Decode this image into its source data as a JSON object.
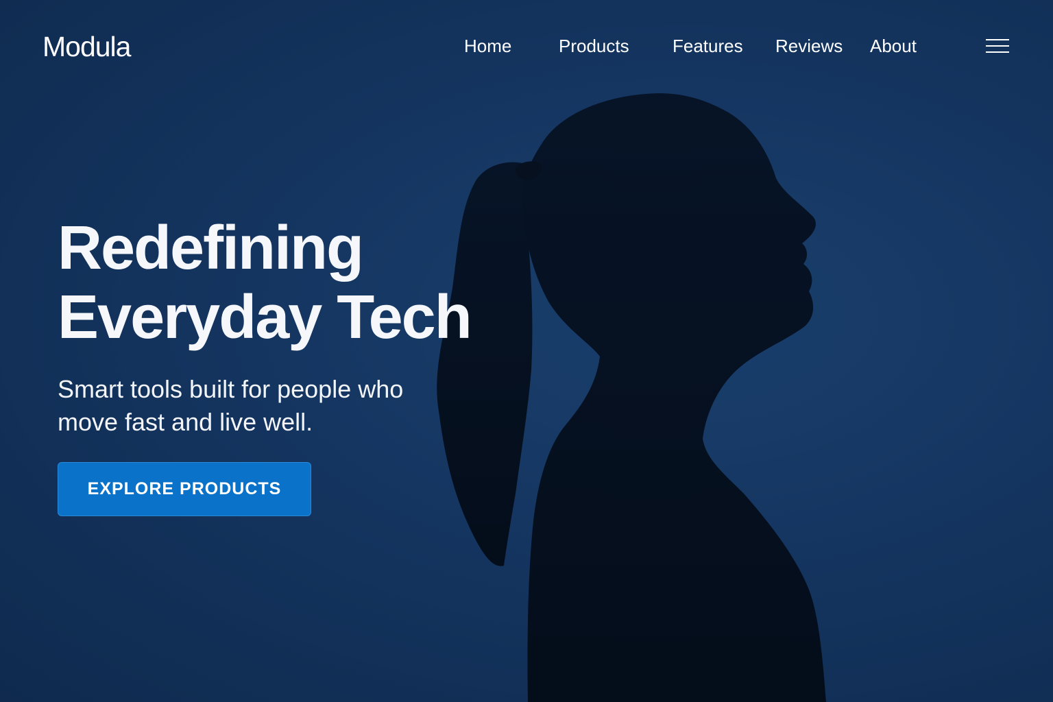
{
  "brand": {
    "name": "Modula"
  },
  "nav": {
    "items": [
      {
        "label": "Home"
      },
      {
        "label": "Products"
      },
      {
        "label": "Features"
      },
      {
        "label": "Reviews"
      },
      {
        "label": "About"
      }
    ],
    "menu_icon": "hamburger-menu-icon"
  },
  "hero": {
    "title_line1": "Redefining",
    "title_line2": "Everyday Tech",
    "subtitle": "Smart tools built for people who move fast and live well.",
    "cta_label": "EXPLORE PRODUCTS",
    "image_subject": "woman-silhouette-profile"
  },
  "colors": {
    "background": "#143560",
    "accent": "#0a72c8",
    "text": "#ffffff",
    "silhouette": "#050f1d"
  }
}
